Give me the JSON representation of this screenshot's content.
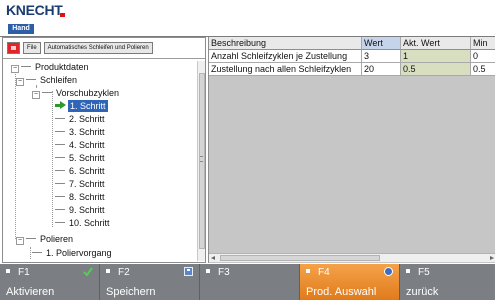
{
  "brand": {
    "logo": "KNECHT",
    "mode": "Hand"
  },
  "toolbar": {
    "buttons": [
      "File",
      "Automatisches Schleifen und Polieren"
    ]
  },
  "tree": {
    "nodes": [
      {
        "label": "Produktdaten"
      },
      {
        "label": "Schleifen"
      },
      {
        "label": "Vorschubzyklen"
      },
      {
        "label": "1. Schritt",
        "selected": true
      },
      {
        "label": "2. Schritt"
      },
      {
        "label": "3. Schritt"
      },
      {
        "label": "4. Schritt"
      },
      {
        "label": "5. Schritt"
      },
      {
        "label": "6. Schritt"
      },
      {
        "label": "7. Schritt"
      },
      {
        "label": "8. Schritt"
      },
      {
        "label": "9. Schritt"
      },
      {
        "label": "10. Schritt"
      },
      {
        "label": "Polieren"
      },
      {
        "label": "1. Poliervorgang"
      }
    ]
  },
  "grid": {
    "headers": [
      "Beschreibung",
      "Wert",
      "Akt. Wert",
      "Min"
    ],
    "rows": [
      [
        "Anzahl Schleifzyklen je Zustellung",
        "3",
        "1",
        "0"
      ],
      [
        "Zustellung nach allen Schleifzyklen",
        "20",
        "0.5",
        "0.5"
      ]
    ]
  },
  "fkeys": [
    {
      "code": "F1",
      "label": "Aktivieren",
      "icon": "check-icon"
    },
    {
      "code": "F2",
      "label": "Speichern",
      "icon": "disk-icon"
    },
    {
      "code": "F3",
      "label": ""
    },
    {
      "code": "F4",
      "label": "Prod. Auswahl",
      "icon": "circle-icon",
      "active": true
    },
    {
      "code": "F5",
      "label": "zurück"
    }
  ],
  "colors": {
    "accent": "#2f64b7",
    "fkey_active": "#e98a2c",
    "fkey_bar": "#7b7f83",
    "record_button": "#e0242a",
    "brand_blue": "#1a3c73"
  }
}
